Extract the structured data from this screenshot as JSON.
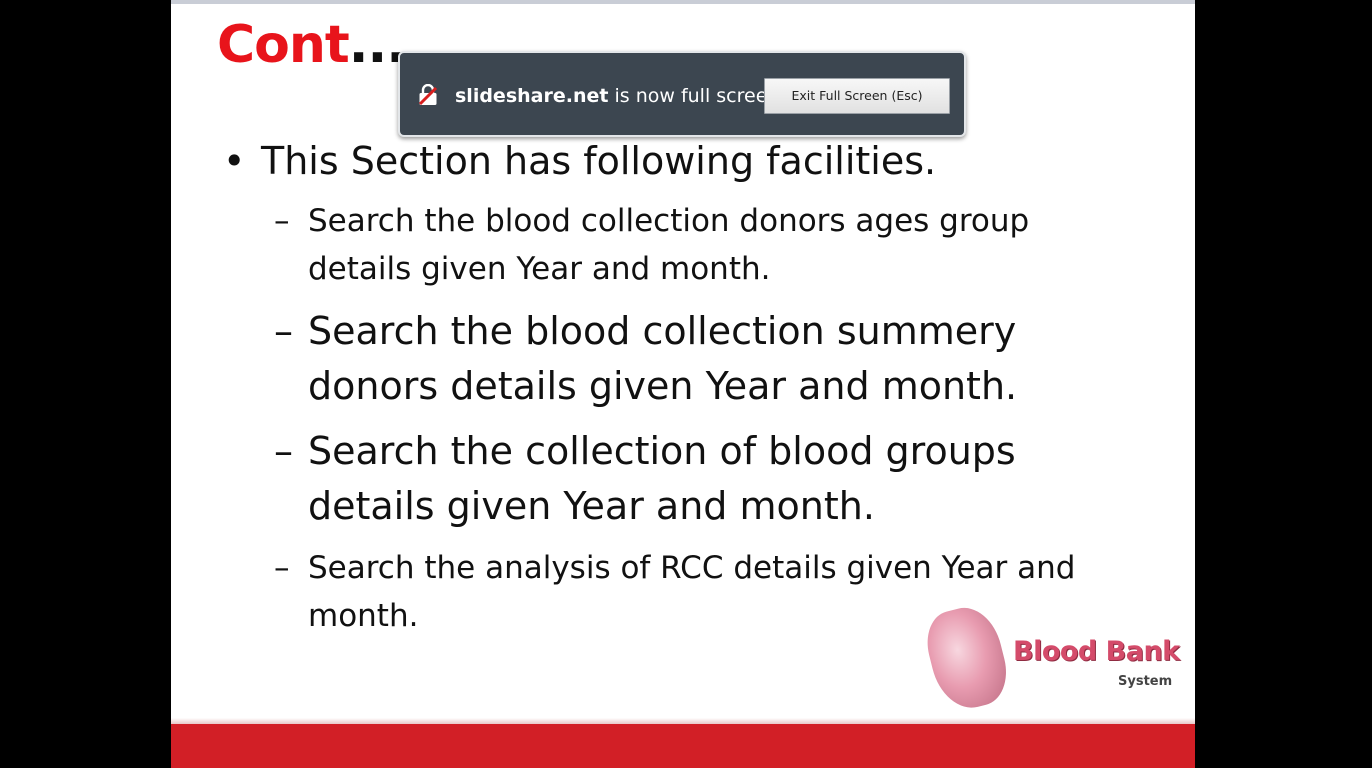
{
  "slide": {
    "title": "Cont",
    "title_suffix": "....",
    "bullet": "This Section has following facilities.",
    "subitems": [
      {
        "dash": "–",
        "line1": "Search the blood collection donors ages group",
        "line2": "details given Year and month."
      },
      {
        "dash": "–",
        "line1": "Search the blood collection summery",
        "line2": "donors  details given Year and month."
      },
      {
        "dash": "–",
        "line1": "Search the collection of blood groups",
        "line2": "details given Year and month."
      },
      {
        "dash": "–",
        "line1": "Search the analysis of RCC  details given Year and",
        "line2": "month."
      }
    ],
    "logo": {
      "title": "Blood Bank",
      "subtitle": "System"
    },
    "colors": {
      "title_red": "#e8141b",
      "band_red": "#d21f26"
    }
  },
  "fullscreen_notice": {
    "site": "slideshare.net",
    "message": " is now full screen",
    "exit_button_label": "Exit Full Screen (Esc)",
    "icon": "fullscreen-lock-icon"
  }
}
